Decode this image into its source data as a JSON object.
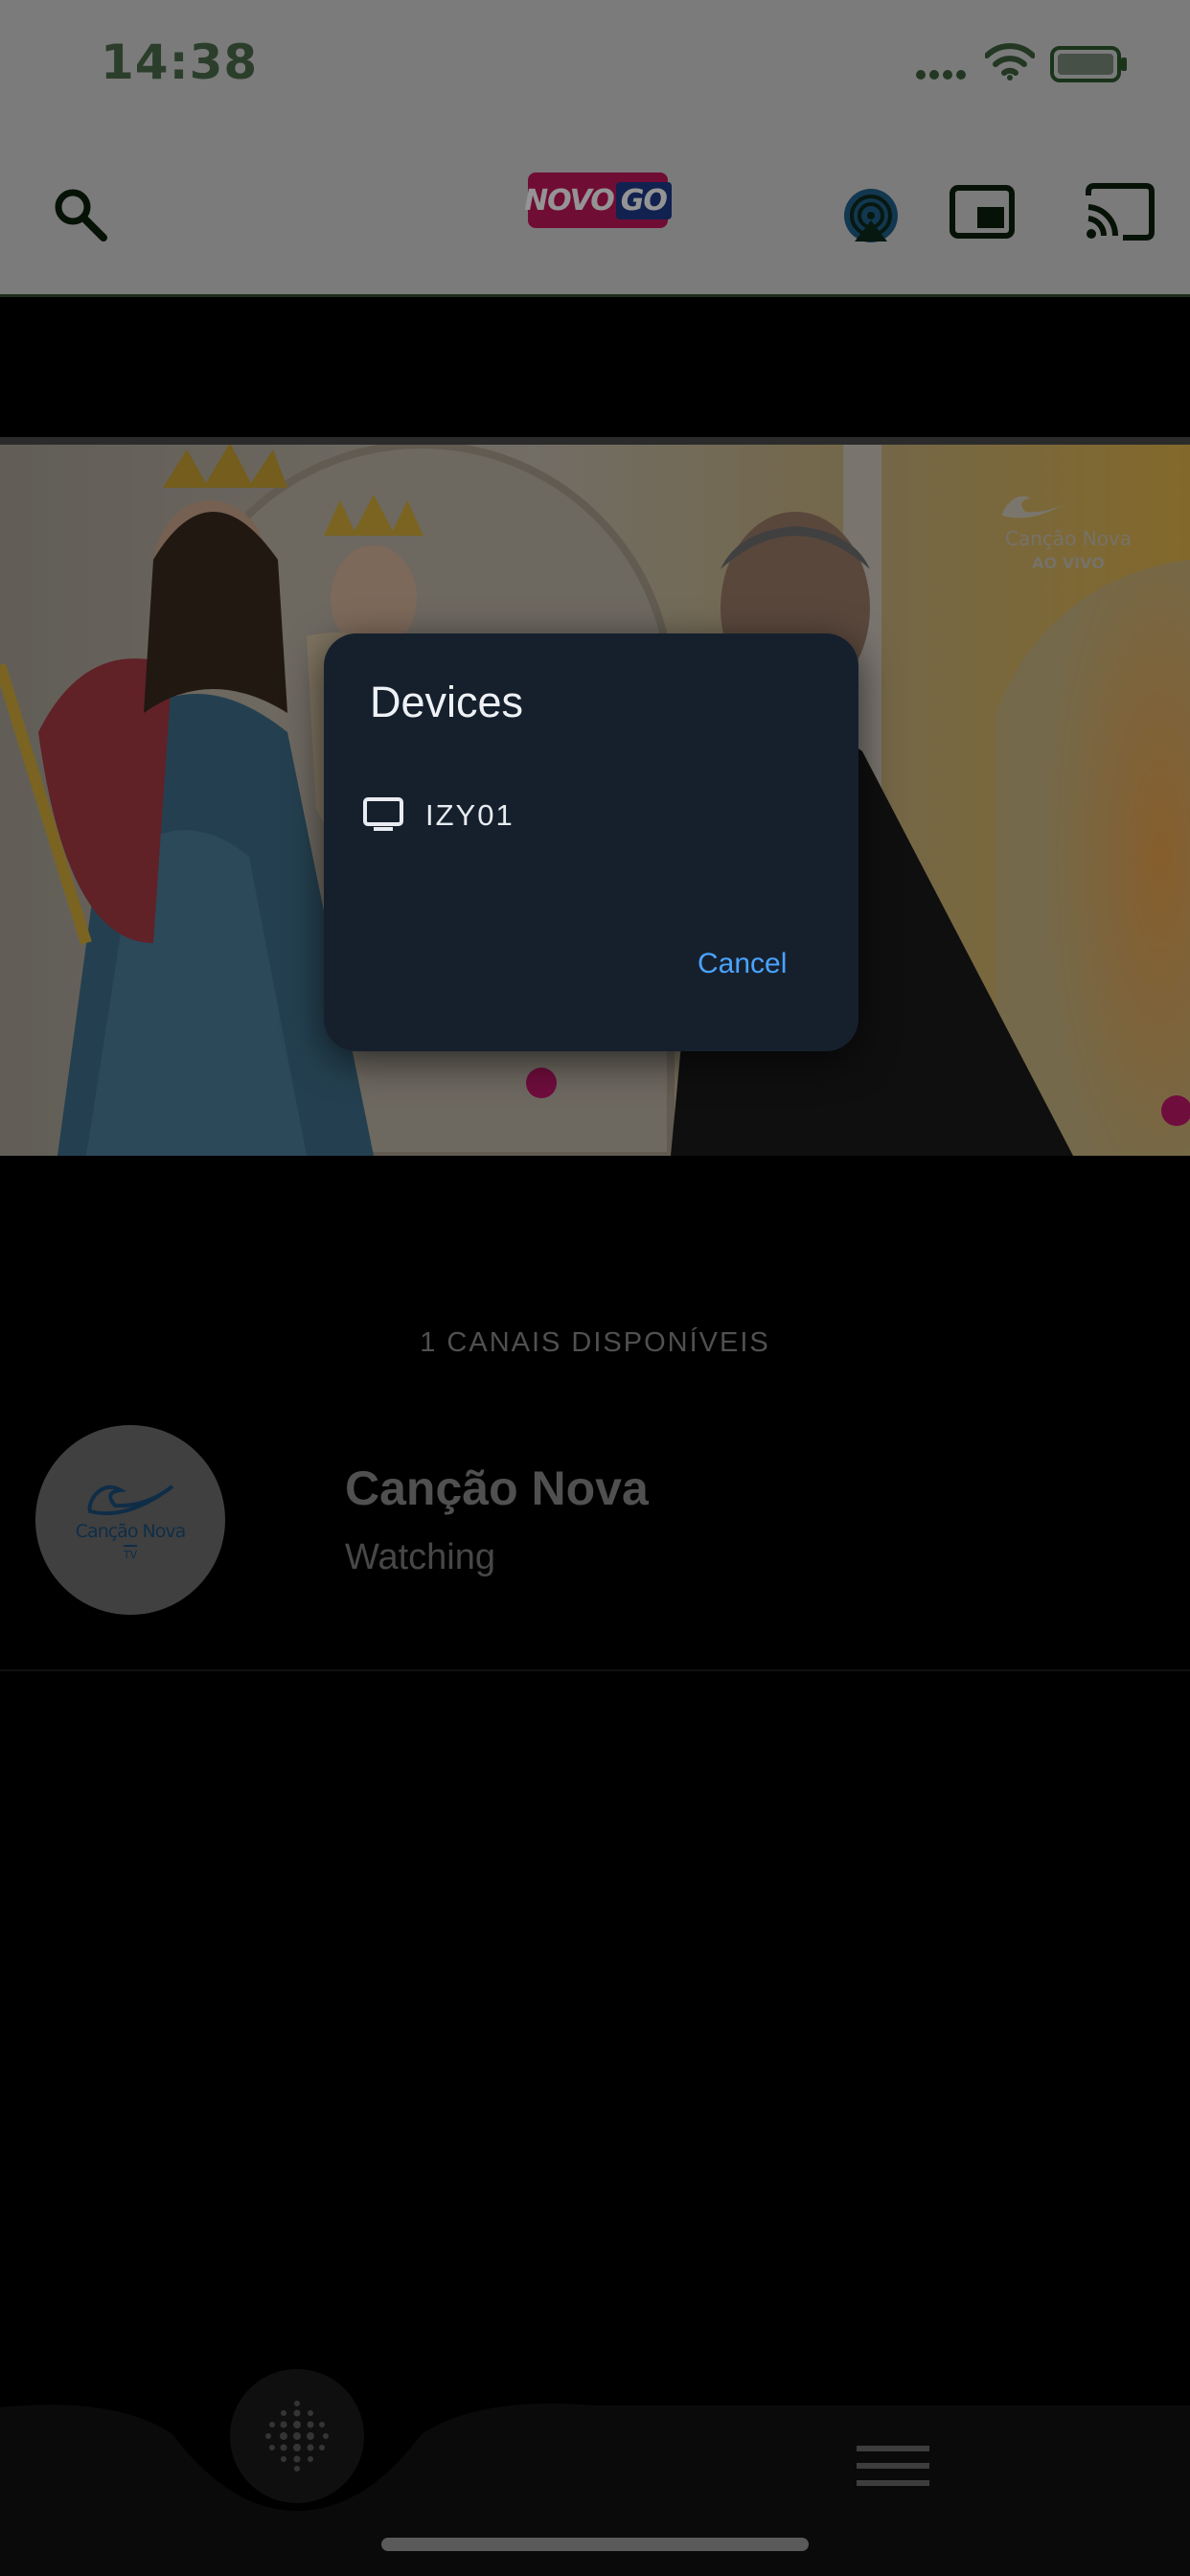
{
  "status_bar": {
    "time": "14:38",
    "icons": [
      "cellular-signal-icon",
      "wifi-icon",
      "battery-icon"
    ]
  },
  "header": {
    "brand_logo": {
      "part_a": "NOVO",
      "part_b": "GO"
    },
    "icons": [
      "search-icon",
      "airplay-icon",
      "picture-in-picture-icon",
      "cast-icon"
    ]
  },
  "video": {
    "watermark_brand": "Canção Nova",
    "watermark_live": "AO VIVO"
  },
  "channels": {
    "count_label": "1 CANAIS DISPONÍVEIS",
    "items": [
      {
        "name": "Canção Nova",
        "status": "Watching",
        "avatar_text": "Canção Nova",
        "avatar_sub": "TV"
      }
    ]
  },
  "dialog": {
    "title": "Devices",
    "devices": [
      {
        "name": "IZY01",
        "icon": "tv-icon"
      }
    ],
    "cancel_label": "Cancel"
  },
  "bottom_nav": {
    "icons": [
      "grid-dots-icon",
      "menu-icon"
    ]
  },
  "colors": {
    "header_bg": "#d4d4d4",
    "dialog_bg": "#16202d",
    "accent": "#4aa3ff",
    "brand": "#c2185b"
  }
}
